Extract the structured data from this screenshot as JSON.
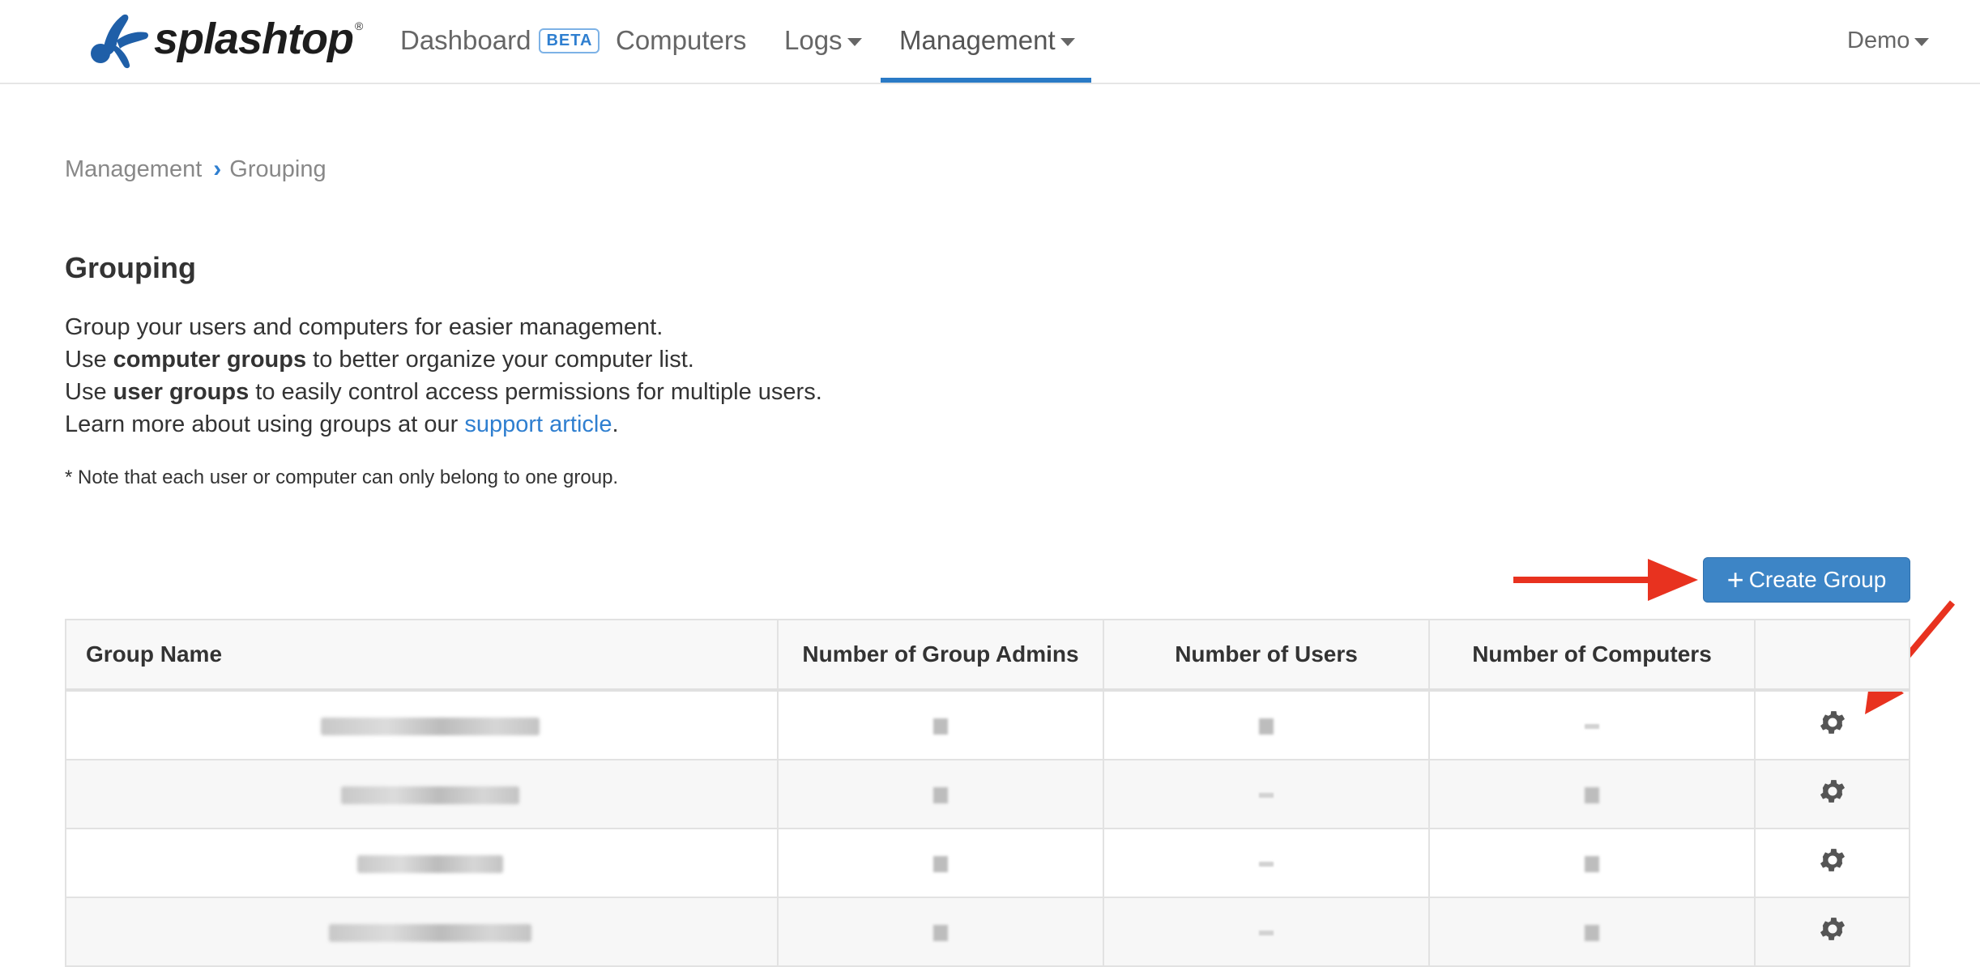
{
  "nav": {
    "brand": "splashtop",
    "brand_mark": "®",
    "items": [
      {
        "label": "Dashboard",
        "badge": "BETA"
      },
      {
        "label": "Computers"
      },
      {
        "label": "Logs"
      },
      {
        "label": "Management"
      }
    ],
    "account": "Demo"
  },
  "breadcrumb": {
    "parent": "Management",
    "current": "Grouping"
  },
  "page": {
    "title": "Grouping",
    "line1": "Group your users and computers for easier management.",
    "line2_pre": "Use ",
    "line2_bold": "computer groups",
    "line2_post": " to better organize your computer list.",
    "line3_pre": "Use ",
    "line3_bold": "user groups",
    "line3_post": " to easily control access permissions for multiple users.",
    "line4_pre": "Learn more about using groups at our ",
    "line4_link": "support article",
    "line4_post": ".",
    "note": "* Note that each user or computer can only belong to one group."
  },
  "actions": {
    "create_group": "Create Group"
  },
  "table": {
    "columns": [
      "Group Name",
      "Number of Group Admins",
      "Number of Users",
      "Number of Computers",
      ""
    ]
  },
  "colors": {
    "accent": "#3d85c6",
    "link": "#2f7fd0",
    "annotation_arrow": "#e8321f"
  },
  "icons": [
    "splashtop-logo",
    "caret-down-icon",
    "chevron-right-icon",
    "plus-icon",
    "gear-icon"
  ]
}
